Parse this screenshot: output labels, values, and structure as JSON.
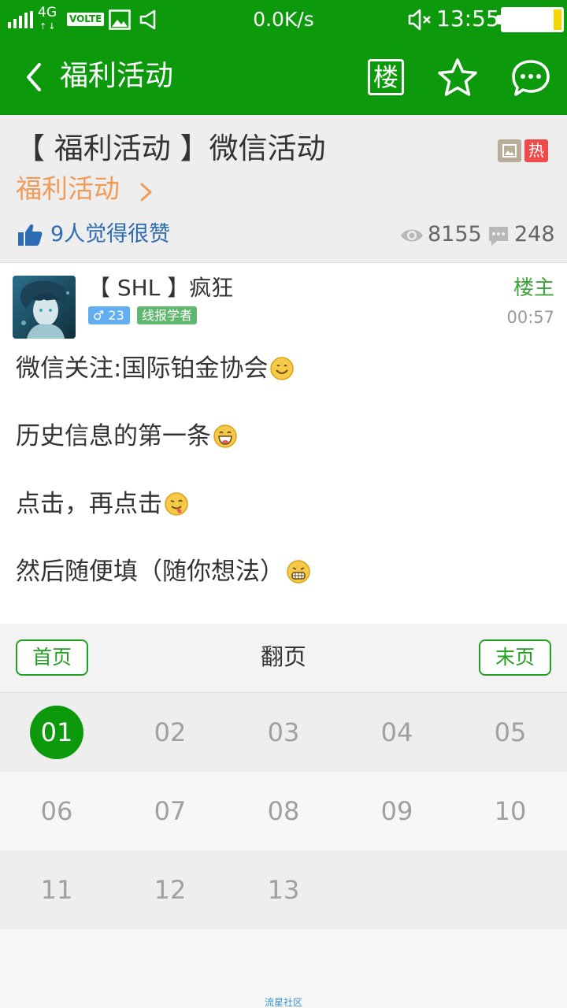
{
  "status_bar": {
    "network": "4G",
    "volte": "VOLTE",
    "speed": "0.0K/s",
    "time": "13:55",
    "battery_level": 0.12
  },
  "nav": {
    "title": "福利活动",
    "floor_label": "楼"
  },
  "post_header": {
    "title": "【 福利活动 】微信活动",
    "category": "福利活动",
    "badge_hot": "热",
    "likes": "9人觉得很赞",
    "views": "8155",
    "comments": "248"
  },
  "post": {
    "author": "【 SHL 】疯狂",
    "gender_level": "♂ 23",
    "rank": "线报学者",
    "role": "楼主",
    "time": "00:57",
    "lines": [
      {
        "text": "微信关注:国际铂金协会",
        "emoji": "smile"
      },
      {
        "text": "历史信息的第一条",
        "emoji": "grin"
      },
      {
        "text": "点击，再点击",
        "emoji": "tongue"
      },
      {
        "text": "然后随便填（随你想法）",
        "emoji": "grimace"
      }
    ]
  },
  "pager": {
    "first": "首页",
    "label": "翻页",
    "last": "末页",
    "pages": [
      "01",
      "02",
      "03",
      "04",
      "05",
      "06",
      "07",
      "08",
      "09",
      "10",
      "11",
      "12",
      "13"
    ],
    "current": "01"
  },
  "footer": "流星社区"
}
